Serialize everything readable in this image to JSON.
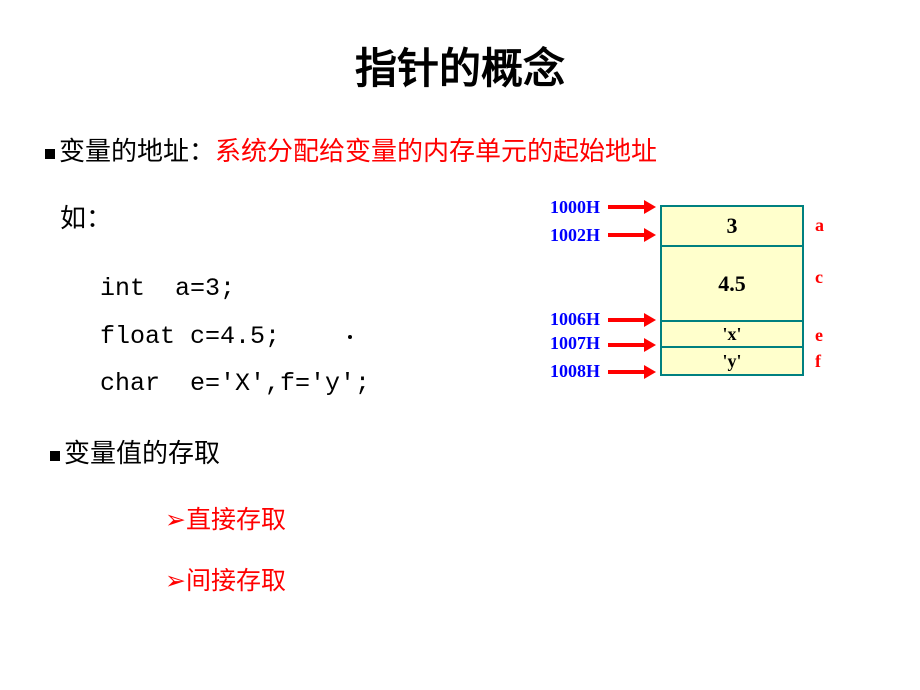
{
  "title": "指针的概念",
  "bullet1_label": "变量的地址：",
  "bullet1_desc": "系统分配给变量的内存单元的起始地址",
  "example_label": "如：",
  "code": {
    "line1": "int  a=3;",
    "line2": "float c=4.5;",
    "line3": "char  e='X',f='y';"
  },
  "bullet2_label": "变量值的存取",
  "sub_bullets": {
    "item1": "直接存取",
    "item2": "间接存取"
  },
  "memory": {
    "addresses": {
      "a1": "1000H",
      "a2": "1002H",
      "a3": "1006H",
      "a4": "1007H",
      "a5": "1008H"
    },
    "cells": {
      "a": "3",
      "c": "4.5",
      "e": "'x'",
      "f": "'y'"
    },
    "vars": {
      "a": "a",
      "c": "c",
      "e": "e",
      "f": "f"
    }
  }
}
